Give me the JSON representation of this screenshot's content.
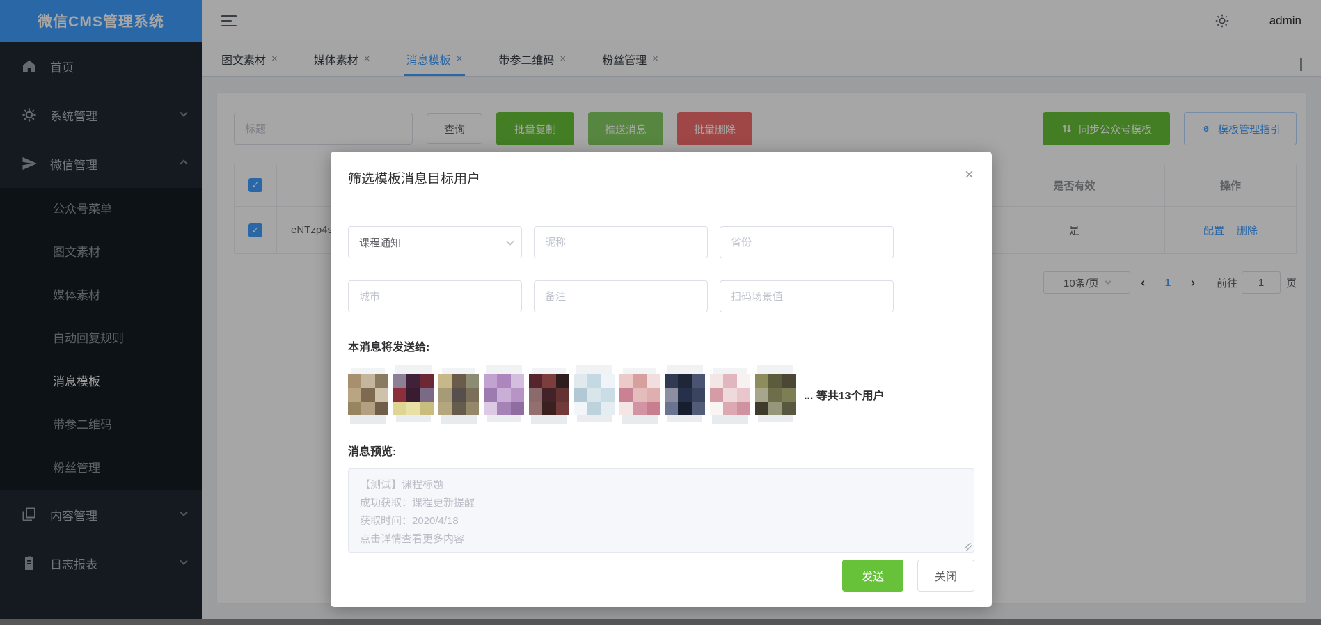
{
  "app": {
    "logo_title": "微信CMS管理系统",
    "username": "admin"
  },
  "icons": {
    "close": "×",
    "check": "✓",
    "prev": "‹",
    "next": "›"
  },
  "sidebar": {
    "items": [
      {
        "label": "首页"
      },
      {
        "label": "系统管理"
      },
      {
        "label": "微信管理"
      },
      {
        "label": "内容管理"
      },
      {
        "label": "日志报表"
      }
    ],
    "submenu": [
      "公众号菜单",
      "图文素材",
      "媒体素材",
      "自动回复规则",
      "消息模板",
      "带参二维码",
      "粉丝管理"
    ],
    "active_item": "消息模板"
  },
  "tabs": [
    "图文素材",
    "媒体素材",
    "消息模板",
    "带参二维码",
    "粉丝管理"
  ],
  "toolbar": {
    "title_placeholder": "标题",
    "query": "查询",
    "batch_copy": "批量复制",
    "push_message": "推送消息",
    "batch_delete": "批量删除",
    "sync_template": "同步公众号模板",
    "guide": "模板管理指引"
  },
  "table": {
    "col_valid": "是否有效",
    "col_action": "操作",
    "row": {
      "template_id": "eNTzp4s",
      "valid": "是",
      "action_config": "配置",
      "action_delete": "删除"
    }
  },
  "pagination": {
    "size": "10条/页",
    "page": "1",
    "goto": "前往",
    "goto_value": "1",
    "unit": "页"
  },
  "dialog": {
    "title": "筛选模板消息目标用户",
    "template_type": "课程通知",
    "placeholders": {
      "nickname": "昵称",
      "province": "省份",
      "city": "城市",
      "remark": "备注",
      "scene": "扫码场景值"
    },
    "send_to_label": "本消息将发送给:",
    "more_users": "... 等共13个用户",
    "preview_label": "消息预览:",
    "preview_lines": [
      "【测试】课程标题",
      "成功获取：课程更新提醒",
      "获取时间：2020/4/18",
      "点击详情查看更多内容"
    ],
    "send": "发送",
    "close": "关闭",
    "avatars": [
      [
        "#a8906f",
        "#c4b69e",
        "#8a7a60",
        "#b9a584",
        "#7d6a50",
        "#cfc2ac",
        "#96855f",
        "#b3a083",
        "#6f5f4a"
      ],
      [
        "#8d7f96",
        "#41203a",
        "#6d2836",
        "#8c2f3d",
        "#3a1c31",
        "#7b6a85",
        "#ded593",
        "#e8e0a4",
        "#c9bd7e"
      ],
      [
        "#c7b88a",
        "#6b5b49",
        "#8c8c73",
        "#a79b77",
        "#55504b",
        "#7c6f59",
        "#b4a67f",
        "#665c4e",
        "#94876a"
      ],
      [
        "#c2a3cf",
        "#ac86bd",
        "#d3bedd",
        "#9d7bb0",
        "#c9aed6",
        "#b695c6",
        "#dccae4",
        "#a583b6",
        "#8f6da1"
      ],
      [
        "#55242c",
        "#7c3d3d",
        "#2f1d1d",
        "#8a6a6a",
        "#44222a",
        "#633232",
        "#936f6f",
        "#3b2020",
        "#713a3a"
      ],
      [
        "#dfe9ee",
        "#c5d9e3",
        "#eef4f7",
        "#b2c8d4",
        "#d8e5eb",
        "#cadde6",
        "#f2f6f8",
        "#bdd2dc",
        "#e4edf1"
      ],
      [
        "#eccaca",
        "#d89f9f",
        "#f2dede",
        "#ca8194",
        "#e5bcbc",
        "#dfaeae",
        "#f5e6e6",
        "#d294a2",
        "#c77f8f"
      ],
      [
        "#303a52",
        "#1e2638",
        "#4a5470",
        "#8e8ea2",
        "#27304a",
        "#3a445e",
        "#6a7490",
        "#161e30",
        "#525c78"
      ],
      [
        "#f2e6e6",
        "#e2b6be",
        "#f7f1f1",
        "#d69ca6",
        "#eedada",
        "#e8c6cc",
        "#faf5f5",
        "#dca8b2",
        "#d092a0"
      ],
      [
        "#8c8c5c",
        "#5c5c3c",
        "#4c4634",
        "#a6a68c",
        "#6e6e4a",
        "#7e7e54",
        "#3e3a2c",
        "#96967a",
        "#585840"
      ]
    ]
  },
  "colors": {
    "primary": "#409EFF",
    "success": "#67c23a",
    "success_light": "#85ce61",
    "danger": "#f56c6c",
    "sidebar_bg": "#1f2831",
    "submenu_bg": "#141c23",
    "page_bg": "#f0f2f5"
  }
}
